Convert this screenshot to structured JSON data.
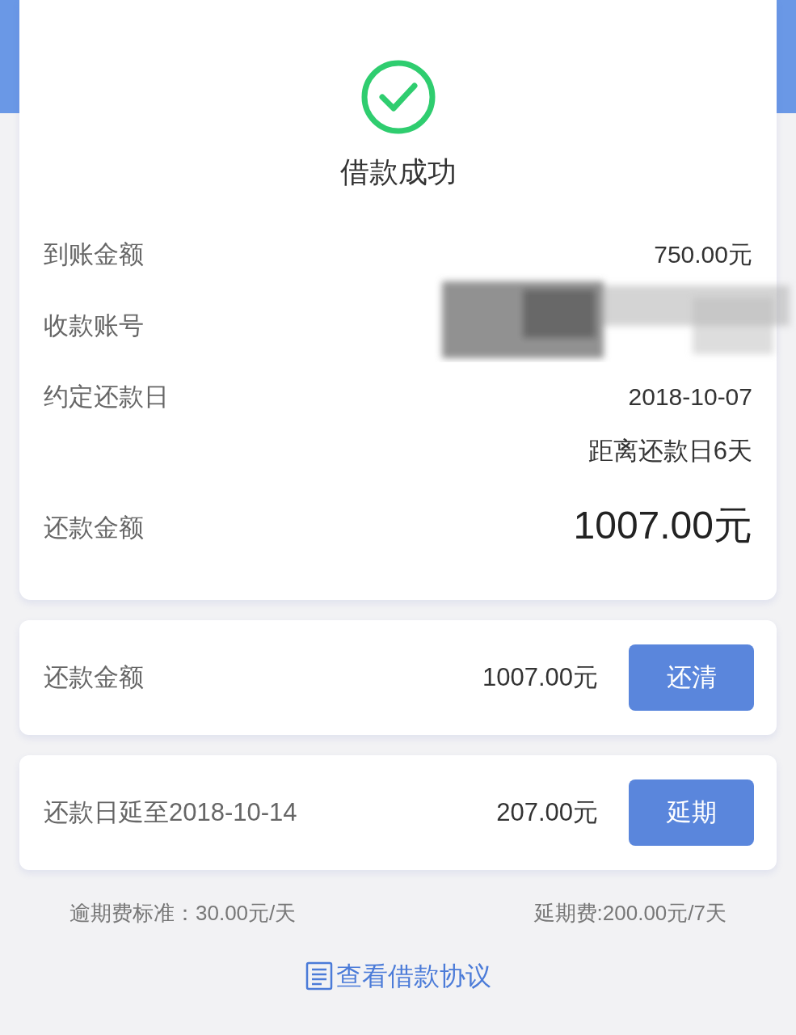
{
  "result": {
    "title": "借款成功",
    "success": true
  },
  "details": [
    {
      "kind": "text",
      "label": "到账金额",
      "value": "750.00元"
    },
    {
      "kind": "redacted",
      "label": "收款账号"
    },
    {
      "kind": "text",
      "label": "约定还款日",
      "value": "2018-10-07",
      "note": "距离还款日6天"
    },
    {
      "kind": "big",
      "label": "还款金额",
      "value": "1007.00元"
    }
  ],
  "actions": [
    {
      "label": "还款金额",
      "amount": "1007.00元",
      "button": "还清"
    },
    {
      "label": "还款日延至2018-10-14",
      "amount": "207.00元",
      "button": "延期"
    }
  ],
  "notes": [
    "逾期费标准：30.00元/天",
    "延期费:200.00元/7天"
  ],
  "link": "查看借款协议"
}
